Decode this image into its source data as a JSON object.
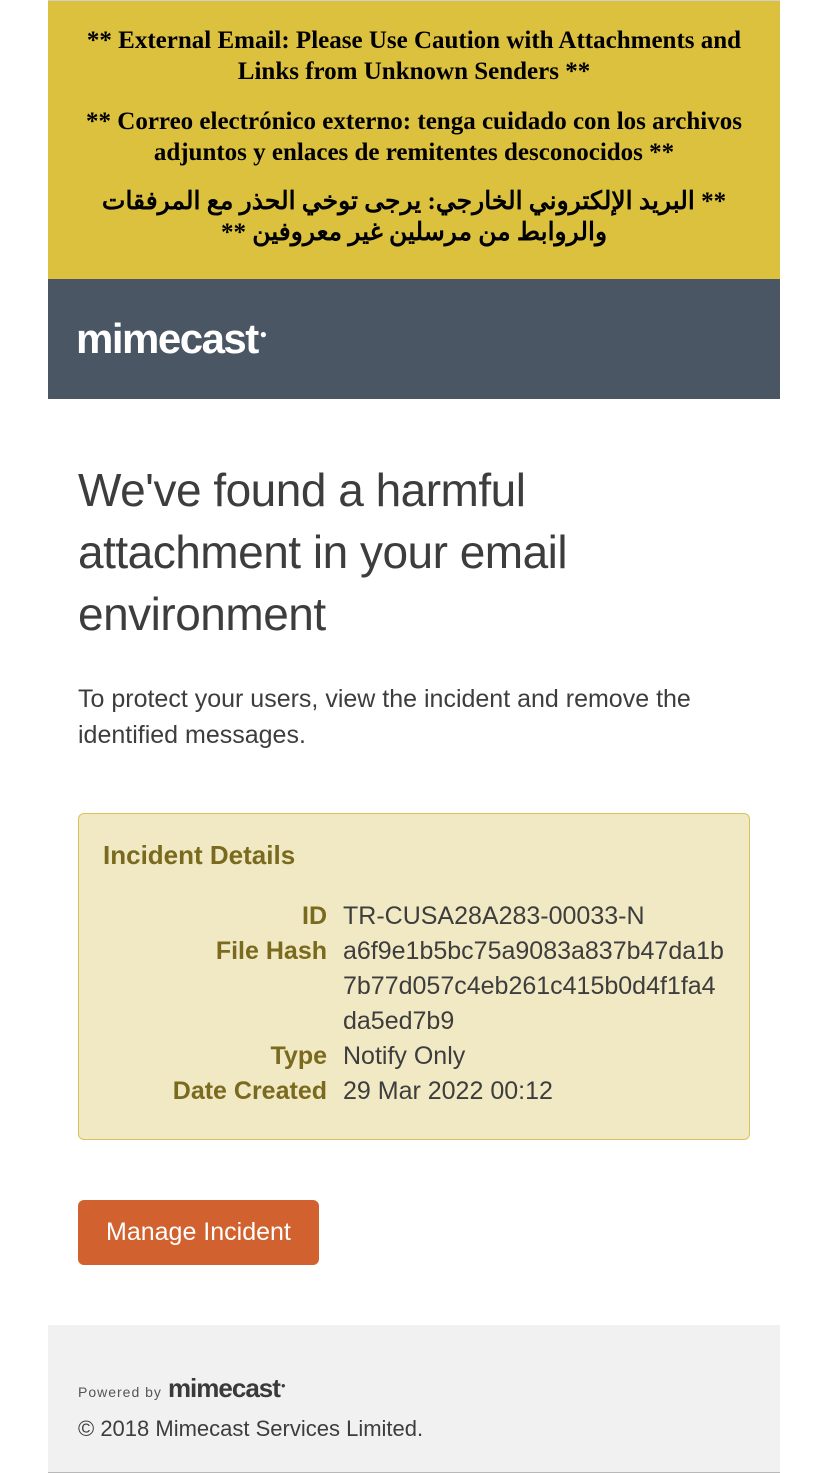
{
  "banner": {
    "en": "** External Email: Please Use Caution with Attachments and Links from Unknown Senders **",
    "es": "** Correo electrónico externo: tenga cuidado con los archivos adjuntos y enlaces de remitentes desconocidos **",
    "ar": "** البريد الإلكتروني الخارجي: يرجى توخي الحذر مع المرفقات والروابط من مرسلين غير معروفين **"
  },
  "brand": "mimecast",
  "headline": "We've found a harmful attachment in your email environment",
  "subtext": "To protect your users, view the incident and remove the identified messages.",
  "incident": {
    "title": "Incident Details",
    "labels": {
      "id": "ID",
      "file_hash": "File Hash",
      "type": "Type",
      "date_created": "Date Created"
    },
    "id": "TR-CUSA28A283-00033-N",
    "file_hash": "a6f9e1b5bc75a9083a837b47da1b7b77d057c4eb261c415b0d4f1fa4da5ed7b9",
    "type": "Notify Only",
    "date_created": "29 Mar 2022 00:12"
  },
  "cta": "Manage Incident",
  "footer": {
    "powered_by": "Powered by",
    "brand": "mimecast",
    "copyright": "© 2018 Mimecast Services Limited."
  }
}
